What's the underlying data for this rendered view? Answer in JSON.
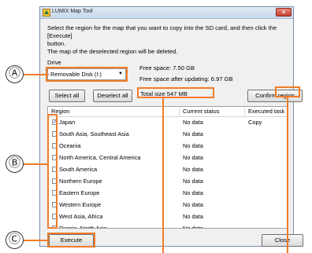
{
  "window": {
    "title": "LUMIX Map Tool",
    "close_glyph": "✕"
  },
  "instructions": {
    "line1": "Select the region for the map that you want to copy into the SD card, and then click the [Execute]",
    "line2": "button.",
    "line3": "The map of the deselected region will be deleted."
  },
  "drive": {
    "label": "Drive",
    "selected": "Removable Disk (I:)",
    "free_space": "Free space: 7.50 GB",
    "free_space_after": "Free space after updating: 6.97 GB"
  },
  "toolbar": {
    "select_all": "Select all",
    "deselect_all": "Deselect all",
    "total_size": "Total size  547 MB",
    "confirm_region": "Confirm region"
  },
  "list": {
    "headers": {
      "region": "Region",
      "status": "Current status",
      "task": "Executed task"
    },
    "rows": [
      {
        "name": "Japan",
        "status": "No data",
        "task": "Copy",
        "checked": true
      },
      {
        "name": "South Asia, Southeast Asia",
        "status": "No data",
        "task": "",
        "checked": false
      },
      {
        "name": "Oceania",
        "status": "No data",
        "task": "",
        "checked": false
      },
      {
        "name": "North America, Central America",
        "status": "No data",
        "task": "",
        "checked": false
      },
      {
        "name": "South America",
        "status": "No data",
        "task": "",
        "checked": false
      },
      {
        "name": "Northern Europe",
        "status": "No data",
        "task": "",
        "checked": false
      },
      {
        "name": "Eastern Europe",
        "status": "No data",
        "task": "",
        "checked": false
      },
      {
        "name": "Western Europe",
        "status": "No data",
        "task": "",
        "checked": false
      },
      {
        "name": "West Asia, Africa",
        "status": "No data",
        "task": "",
        "checked": false
      },
      {
        "name": "Russia, North Asia",
        "status": "No data",
        "task": "",
        "checked": false
      }
    ]
  },
  "footer": {
    "execute": "Execute",
    "close": "Close"
  },
  "callouts": {
    "a": "Ⓐ",
    "b": "Ⓑ",
    "c": "Ⓒ"
  },
  "colors": {
    "annotation": "#f07c28"
  },
  "icons": {
    "app": "map-icon",
    "close": "close-icon",
    "dropdown": "chevron-down-icon"
  }
}
